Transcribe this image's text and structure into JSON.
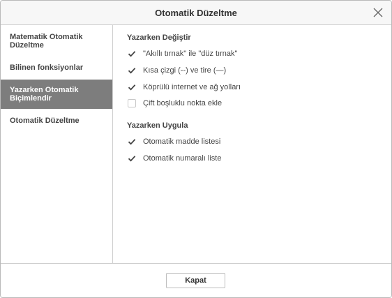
{
  "dialog": {
    "title": "Otomatik Düzeltme",
    "close_icon": "close-icon"
  },
  "sidebar": {
    "items": [
      {
        "label": "Matematik Otomatik Düzeltme",
        "active": false
      },
      {
        "label": "Bilinen fonksiyonlar",
        "active": false
      },
      {
        "label": "Yazarken Otomatik Biçimlendir",
        "active": true
      },
      {
        "label": "Otomatik Düzeltme",
        "active": false
      }
    ]
  },
  "content": {
    "groups": [
      {
        "title": "Yazarken Değiştir",
        "options": [
          {
            "label": "\"Akıllı tırnak\" ile \"düz tırnak\"",
            "checked": true
          },
          {
            "label": "Kısa çizgi (--) ve tire (—)",
            "checked": true
          },
          {
            "label": "Köprülü internet ve ağ yolları",
            "checked": true
          },
          {
            "label": "Çift boşluklu nokta ekle",
            "checked": false
          }
        ]
      },
      {
        "title": "Yazarken Uygula",
        "options": [
          {
            "label": "Otomatik madde listesi",
            "checked": true
          },
          {
            "label": "Otomatik numaralı liste",
            "checked": true
          }
        ]
      }
    ]
  },
  "footer": {
    "close_button_label": "Kapat"
  },
  "colors": {
    "sidebar_active_bg": "#7d7d7d",
    "border": "#cfcfcf",
    "text": "#444444",
    "checkmark": "#444444"
  }
}
